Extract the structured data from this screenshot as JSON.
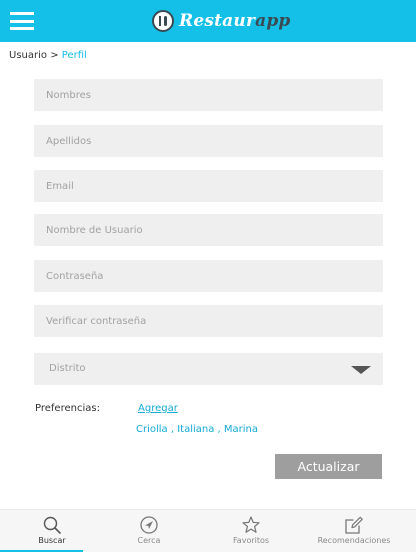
{
  "app": {
    "name_prefix": "Restaur",
    "name_suffix": "app",
    "brand_color": "#14bfe8"
  },
  "breadcrumb": {
    "parent": "Usuario",
    "separator": ">",
    "current": "Perfil"
  },
  "form": {
    "nombres_placeholder": "Nombres",
    "apellidos_placeholder": "Apellidos",
    "email_placeholder": "Email",
    "usuario_placeholder": "Nombre de Usuario",
    "password_placeholder": "Contraseña",
    "verify_password_placeholder": "Verificar contraseña",
    "distrito_label": "Distrito",
    "preferences_label": "Preferencias:",
    "add_link": "Agregar",
    "preferences_values": "Criolla , Italiana , Marina",
    "update_button": "Actualizar"
  },
  "tabs": [
    {
      "label": "Buscar",
      "icon": "search-icon",
      "active": true
    },
    {
      "label": "Cerca",
      "icon": "navigation-icon",
      "active": false
    },
    {
      "label": "Favoritos",
      "icon": "star-icon",
      "active": false
    },
    {
      "label": "Recomendaciones",
      "icon": "edit-icon",
      "active": false
    }
  ]
}
